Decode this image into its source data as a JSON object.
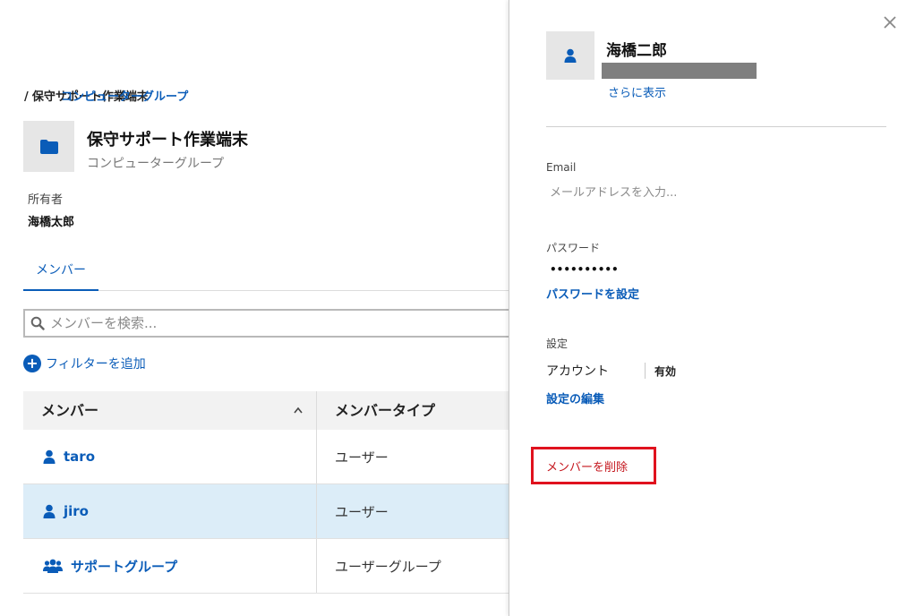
{
  "breadcrumb": {
    "parent": "コンピューターグループ",
    "separator": "/",
    "current": "保守サポート作業端末"
  },
  "group": {
    "title": "保守サポート作業端末",
    "subtitle": "コンピューターグループ",
    "icon": "folder-icon"
  },
  "owner": {
    "label": "所有者",
    "value": "海橋太郎"
  },
  "tabs": [
    {
      "label": "メンバー",
      "active": true
    }
  ],
  "search": {
    "placeholder": "メンバーを検索..."
  },
  "filter": {
    "add_label": "フィルターを追加"
  },
  "table": {
    "columns": [
      "メンバー",
      "メンバータイプ"
    ],
    "sort_indicator": "^",
    "rows": [
      {
        "name": "taro",
        "type": "ユーザー",
        "icon": "user-icon",
        "selected": false
      },
      {
        "name": "jiro",
        "type": "ユーザー",
        "icon": "user-icon",
        "selected": true
      },
      {
        "name": "サポートグループ",
        "type": "ユーザーグループ",
        "icon": "users-icon",
        "selected": false
      }
    ]
  },
  "detail": {
    "name": "海橋二郎",
    "show_more": "さらに表示",
    "email_label": "Email",
    "email_placeholder": "メールアドレスを入力...",
    "password_label": "パスワード",
    "password_mask": "••••••••••",
    "set_password": "パスワードを設定",
    "settings_label": "設定",
    "account_key": "アカウント",
    "account_value": "有効",
    "edit_settings": "設定の編集",
    "remove_member": "メンバーを削除"
  },
  "colors": {
    "accent": "#0a5cb8",
    "selected_row": "#dcedf8",
    "danger": "#e0121e"
  }
}
